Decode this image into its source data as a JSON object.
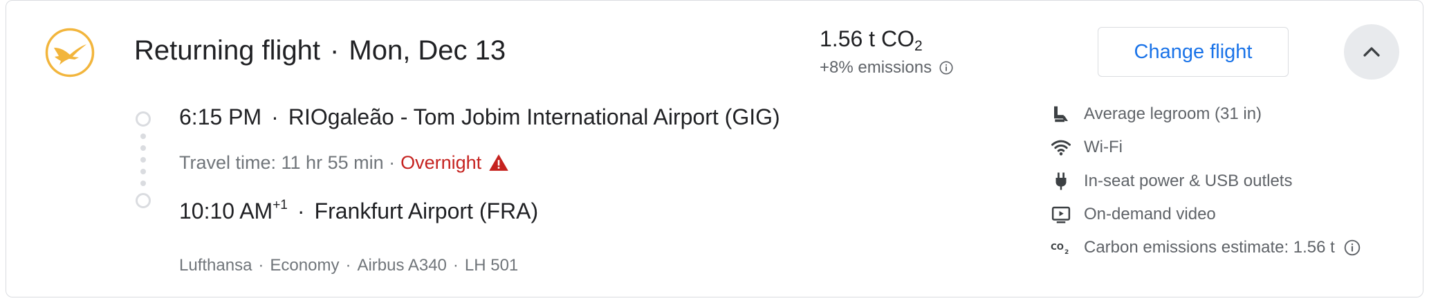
{
  "airline_logo": {
    "icon": "lufthansa-crane-logo",
    "color": "#f2b53c"
  },
  "header": {
    "title": "Returning flight",
    "separator": "·",
    "date": "Mon, Dec 13"
  },
  "emissions": {
    "amount": "1.56 t CO",
    "amount_sub": "2",
    "delta": "+8% emissions",
    "info_icon": "info-icon"
  },
  "actions": {
    "change_flight_label": "Change flight",
    "collapse_icon": "chevron-up-icon"
  },
  "departure": {
    "time": "6:15 PM",
    "separator": "·",
    "airport": "RIOgaleão - Tom Jobim International Airport (GIG)"
  },
  "travel": {
    "text": "Travel time: 11 hr 55 min ·",
    "overnight": "Overnight",
    "warning_icon": "warning-icon",
    "warning_color": "#c5221f"
  },
  "arrival": {
    "time": "10:10 AM",
    "day_offset": "+1",
    "separator": "·",
    "airport": "Frankfurt Airport (FRA)"
  },
  "flight_meta": {
    "airline": "Lufthansa",
    "cabin": "Economy",
    "aircraft": "Airbus A340",
    "flight_number": "LH 501",
    "separator": "·"
  },
  "amenities": [
    {
      "icon": "legroom-seat-icon",
      "label": "Average legroom (31 in)"
    },
    {
      "icon": "wifi-icon",
      "label": "Wi-Fi"
    },
    {
      "icon": "power-plug-icon",
      "label": "In-seat power & USB outlets"
    },
    {
      "icon": "video-icon",
      "label": "On-demand video"
    },
    {
      "icon": "co2-icon",
      "label": "Carbon emissions estimate: 1.56 t"
    }
  ],
  "colors": {
    "link_blue": "#1a73e8",
    "text_dark": "#202124",
    "text_grey": "#5f6368",
    "border": "#dadce0"
  }
}
